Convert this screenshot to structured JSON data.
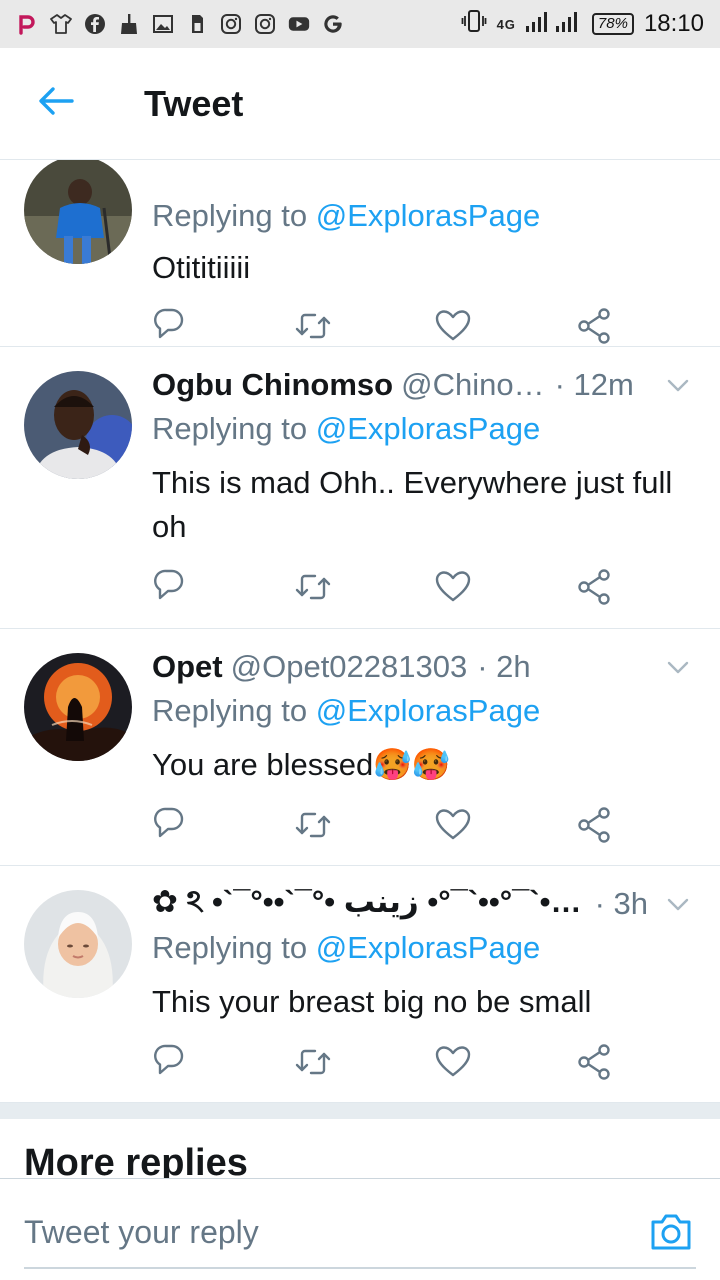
{
  "status_bar": {
    "network": "4G",
    "battery": "78%",
    "time": "18:10",
    "icons": [
      "picsart-icon",
      "tshirt-icon",
      "facebook-icon",
      "broom-icon",
      "gallery-icon",
      "sd-card-icon",
      "instagram-icon",
      "instagram-icon",
      "youtube-icon",
      "google-icon"
    ]
  },
  "header": {
    "title": "Tweet",
    "back_icon": "arrow-left-icon"
  },
  "colors": {
    "accent": "#1da1f2",
    "text": "#14171a",
    "secondary": "#657786",
    "divider": "#e1e8ed"
  },
  "tweets": [
    {
      "name": "",
      "handle": "",
      "time": "",
      "reply_prefix": "Replying to",
      "reply_to": "@ExplorasPage",
      "text": "Otititiiiii"
    },
    {
      "name": "Ogbu Chinomso",
      "handle": "@Chino…",
      "time": "12m",
      "reply_prefix": "Replying to",
      "reply_to": "@ExplorasPage",
      "text": "This is mad Ohh.. Everywhere just full oh"
    },
    {
      "name": "Opet",
      "handle": "@Opet02281303",
      "time": "2h",
      "reply_prefix": "Replying to",
      "reply_to": "@ExplorasPage",
      "text": "You are blessed🥵🥵"
    },
    {
      "name": "✿ ঽ •`¯°••`¯°• زينب •°¯`••°¯`• …",
      "handle": "",
      "time": "3h",
      "reply_prefix": "Replying to",
      "reply_to": "@ExplorasPage",
      "text": "This your breast big no be small"
    }
  ],
  "actions": {
    "reply_icon": "reply-icon",
    "retweet_icon": "retweet-icon",
    "like_icon": "heart-icon",
    "share_icon": "share-icon"
  },
  "more_replies": "More replies",
  "compose": {
    "placeholder": "Tweet your reply",
    "camera_icon": "camera-icon"
  }
}
